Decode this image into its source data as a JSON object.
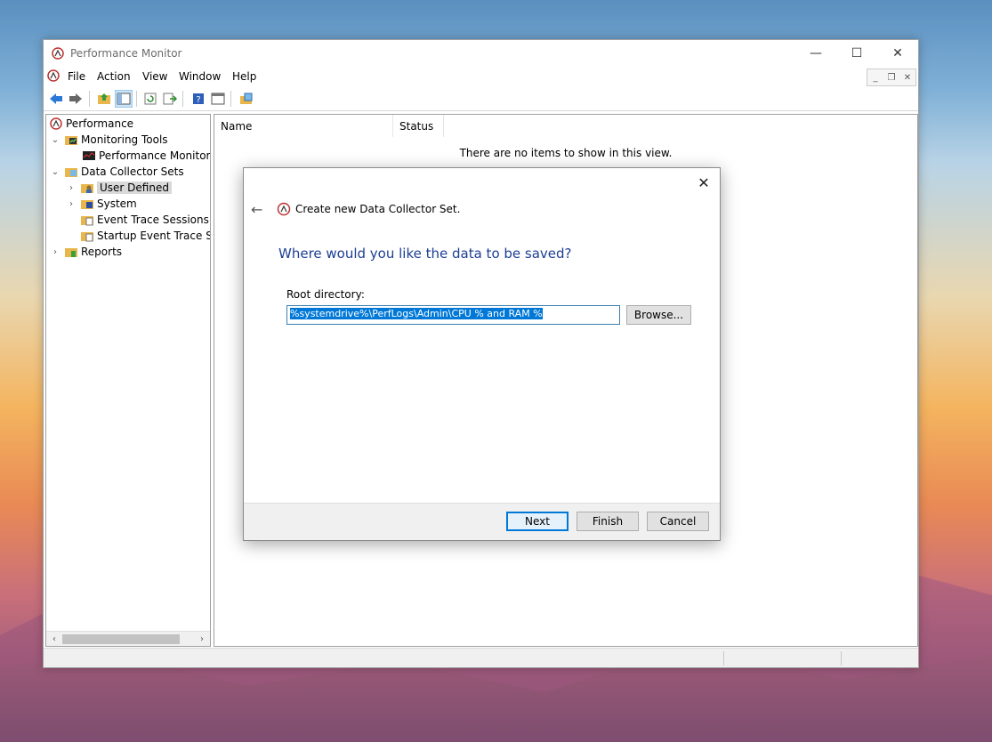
{
  "window": {
    "title": "Performance Monitor",
    "min_glyph": "—",
    "max_glyph": "☐",
    "close_glyph": "✕"
  },
  "menu": {
    "items": [
      "File",
      "Action",
      "View",
      "Window",
      "Help"
    ]
  },
  "tree": {
    "items": [
      {
        "label": "Performance",
        "icon": "perfmon-icon"
      },
      {
        "label": "Monitoring Tools",
        "icon": "folder-chart-icon"
      },
      {
        "label": "Performance Monitor",
        "icon": "chart-monitor-icon"
      },
      {
        "label": "Data Collector Sets",
        "icon": "folder-collector-icon"
      },
      {
        "label": "User Defined",
        "icon": "user-folder-icon",
        "selected": true
      },
      {
        "label": "System",
        "icon": "system-folder-icon"
      },
      {
        "label": "Event Trace Sessions",
        "icon": "trace-folder-icon"
      },
      {
        "label": "Startup Event Trace Sess",
        "icon": "trace-folder-icon"
      },
      {
        "label": "Reports",
        "icon": "reports-folder-icon"
      }
    ]
  },
  "list": {
    "columns": [
      "Name",
      "Status"
    ],
    "empty_message": "There are no items to show in this view."
  },
  "dialog": {
    "close_glyph": "✕",
    "back_glyph": "←",
    "title": "Create new Data Collector Set.",
    "heading": "Where would you like the data to be saved?",
    "root_label": "Root directory:",
    "root_value": "%systemdrive%\\PerfLogs\\Admin\\CPU % and RAM %",
    "browse_label": "Browse...",
    "next_label": "Next",
    "finish_label": "Finish",
    "cancel_label": "Cancel"
  },
  "colors": {
    "heading_blue": "#1c3f94",
    "selection_blue": "#0078d7"
  }
}
